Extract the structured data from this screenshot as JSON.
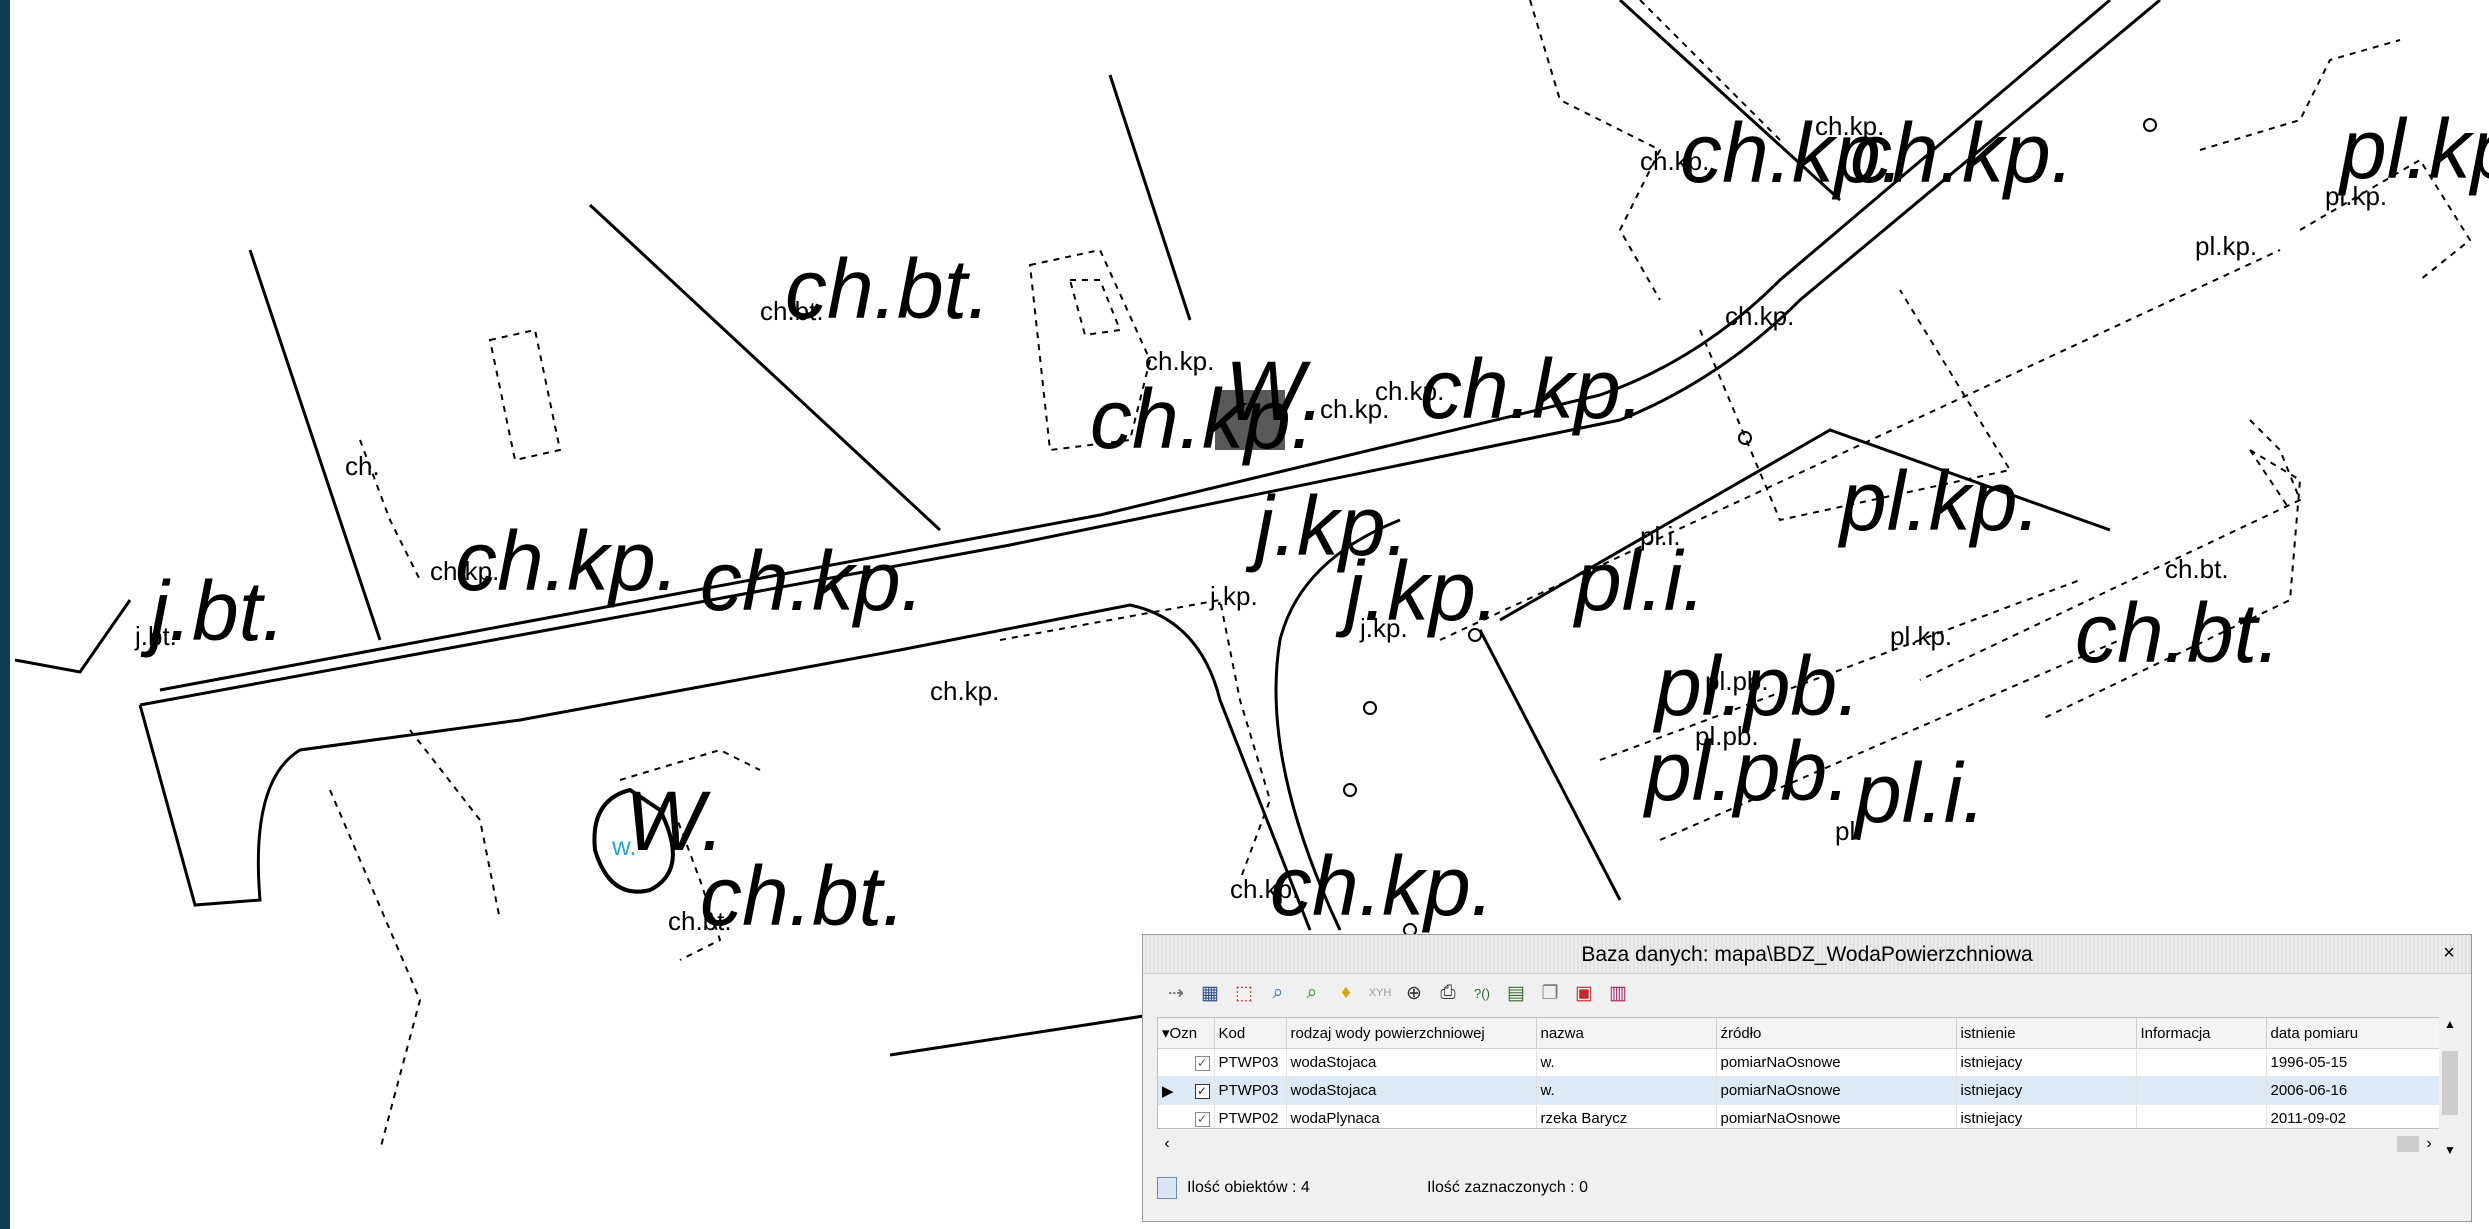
{
  "map": {
    "labels_large": [
      "ch.kp.",
      "ch.kp.",
      "pl.kp",
      "ch.bt.",
      "ch.kp.",
      "W.",
      "ch.kp.",
      "ch.kp.",
      "ch.kp.",
      "j.bt.",
      "j.kp.",
      "j.kp.",
      "pl.i.",
      "pl.kp.",
      "ch.bt.",
      "pl.pb.",
      "pl.pb.",
      "pl.i.",
      "W.",
      "ch.bt.",
      "ch.kp."
    ],
    "labels_small": [
      "ch.kp.",
      "ch.kp.",
      "pl.kp.",
      "pl.kp.",
      "ch.kp.",
      "ch.bt.",
      "ch.kp.",
      "ch.kp.",
      "ch.kp.",
      "ch.",
      "ch.kp.",
      "j.bt.",
      "j.kp.",
      "j.kp.",
      "pl.i.",
      "ch.kp.",
      "ch.bt.",
      "pl.kp.",
      "pl.pb.",
      "pl.pb.",
      "pl.",
      "w.",
      "ch.bt.",
      "ch.kp."
    ]
  },
  "panel": {
    "title": "Baza danych: mapa\\BDZ_WodaPowierzchniowa",
    "close": "×",
    "toolbar_icons": [
      "export-icon",
      "table-icon",
      "select-icon",
      "find-icon",
      "search-next-icon",
      "light-icon",
      "xyh-icon",
      "zoom-icon",
      "print-icon",
      "query-icon",
      "filter-icon",
      "copy-icon",
      "grid-icon",
      "delete-icon"
    ],
    "columns": [
      "Ozn",
      "Kod",
      "rodzaj wody powierzchniowej",
      "nazwa",
      "źródło",
      "istnienie",
      "Informacja",
      "data pomiaru"
    ],
    "rows": [
      {
        "ozn": "✓",
        "kod": "PTWP03",
        "rodzaj": "wodaStojaca",
        "nazwa": "w.",
        "zrodlo": "pomiarNaOsnowe",
        "istnienie": "istniejacy",
        "informacja": "",
        "data": "1996-05-15"
      },
      {
        "ozn": "✓",
        "kod": "PTWP03",
        "rodzaj": "wodaStojaca",
        "nazwa": "w.",
        "zrodlo": "pomiarNaOsnowe",
        "istnienie": "istniejacy",
        "informacja": "",
        "data": "2006-06-16"
      },
      {
        "ozn": "✓",
        "kod": "PTWP02",
        "rodzaj": "wodaPlynaca",
        "nazwa": "rzeka Barycz",
        "zrodlo": "pomiarNaOsnowe",
        "istnienie": "istniejacy",
        "informacja": "",
        "data": "2011-09-02"
      }
    ],
    "selected_row": 1,
    "status_count": "Ilość obiektów : 4",
    "status_selected": "Ilość zaznaczonych : 0",
    "colors": {
      "selection": "#dce9f7",
      "accent_water": "#2aa7d8"
    }
  }
}
